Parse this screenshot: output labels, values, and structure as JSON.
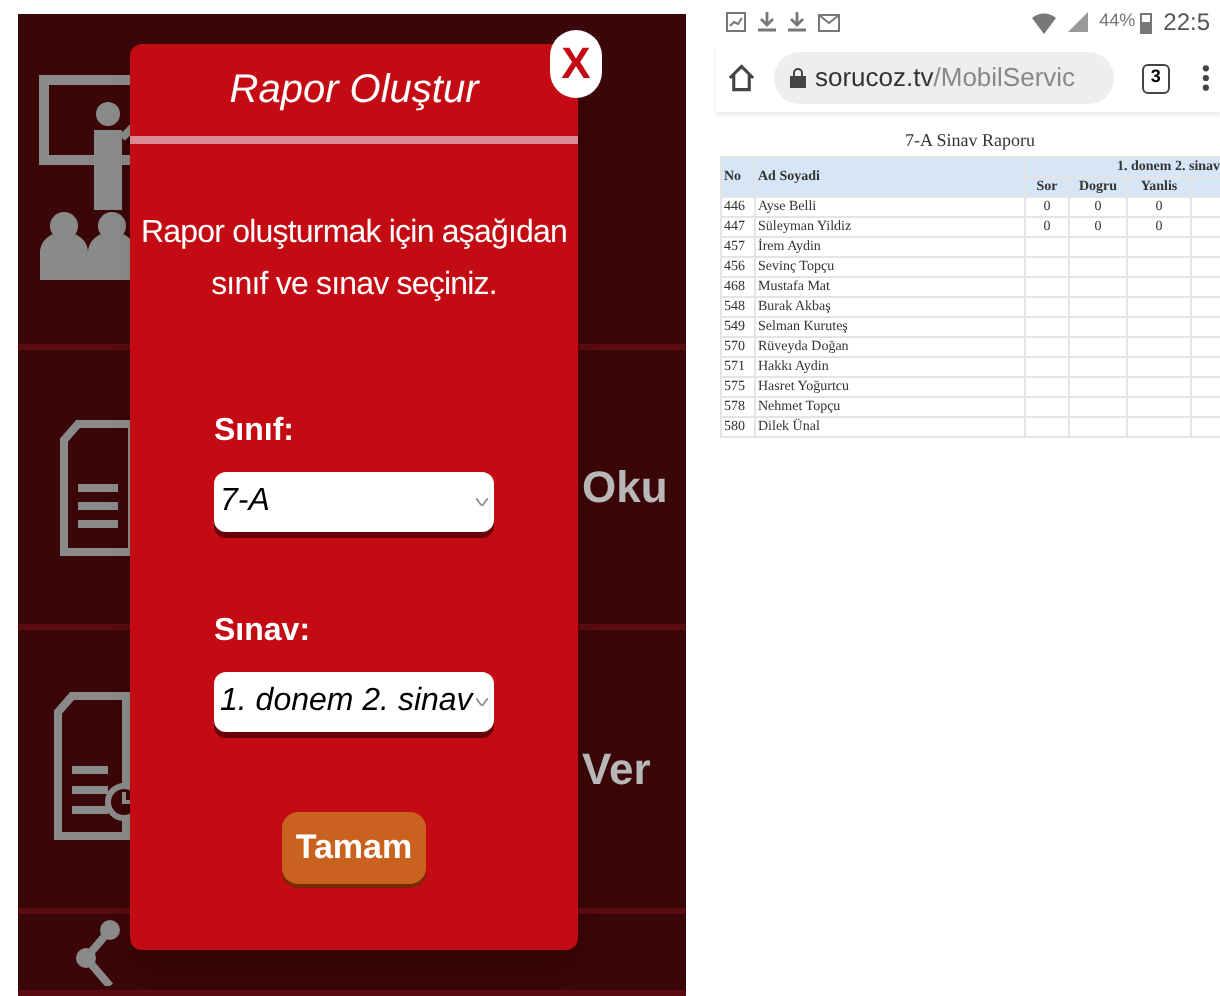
{
  "app": {
    "menu_items": [
      {
        "kind": "presenter"
      },
      {
        "kind": "document",
        "label": "Oku"
      },
      {
        "kind": "document-clock",
        "label": "Ver"
      },
      {
        "kind": "share"
      }
    ],
    "dialog": {
      "close": "X",
      "title": "Rapor Oluştur",
      "message": "Rapor oluşturmak için aşağıdan sınıf ve sınav seçiniz.",
      "fields": [
        {
          "label": "Sınıf:",
          "value": "7-A"
        },
        {
          "label": "Sınav:",
          "value": "1. donem 2. sinav"
        }
      ],
      "button": "Tamam"
    }
  },
  "browser": {
    "status_bar": {
      "battery": "44%",
      "time": "22:5"
    },
    "address_bar": {
      "domain": "sorucoz.tv",
      "path": "/MobilServic"
    },
    "tab_count": "3",
    "report": {
      "title": "7-A Sinav Raporu",
      "columns": [
        "No",
        "Ad Soyadi"
      ],
      "group": "1. donem 2. sinav",
      "subcolumns": [
        "Sor",
        "Dogru",
        "Yanlis"
      ],
      "rows": [
        {
          "no": "446",
          "name": "Ayse Belli",
          "values": [
            "0",
            "0",
            "0"
          ]
        },
        {
          "no": "447",
          "name": "Süleyman Yildiz",
          "values": [
            "0",
            "0",
            "0"
          ]
        },
        {
          "no": "457",
          "name": "İrem Aydin"
        },
        {
          "no": "456",
          "name": "Sevinç Topçu"
        },
        {
          "no": "468",
          "name": "Mustafa Mat"
        },
        {
          "no": "548",
          "name": "Burak Akbaş"
        },
        {
          "no": "549",
          "name": "Selman Kuruteş"
        },
        {
          "no": "570",
          "name": "Rüveyda Doğan"
        },
        {
          "no": "571",
          "name": "Hakkı Aydin"
        },
        {
          "no": "575",
          "name": "Hasret Yoğurtcu"
        },
        {
          "no": "578",
          "name": "Nehmet Topçu"
        },
        {
          "no": "580",
          "name": "Dilek Ünal"
        }
      ]
    }
  }
}
